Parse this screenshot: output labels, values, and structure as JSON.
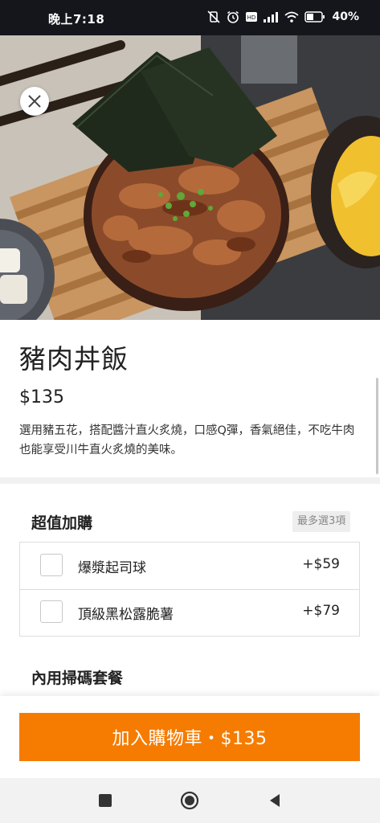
{
  "status_bar": {
    "time": "晚上7:18",
    "battery": "40%",
    "icons": [
      "vibrate-off-icon",
      "alarm-icon",
      "volte-icon",
      "signal-icon",
      "wifi-icon",
      "battery-icon"
    ]
  },
  "hero": {
    "image_alt": "dish-photo",
    "close_icon": "close-icon"
  },
  "product": {
    "name": "豬肉丼飯",
    "price": "$135",
    "description": "選用豬五花，搭配醬汁直火炙燒，口感Q彈，香氣絕佳，不吃牛肉也能享受川牛直火炙燒的美味。"
  },
  "addons": {
    "title": "超值加購",
    "max_label": "最多選3項",
    "options": [
      {
        "name": "爆漿起司球",
        "price": "+$59",
        "checked": false
      },
      {
        "name": "頂級黑松露脆薯",
        "price": "+$79",
        "checked": false
      }
    ]
  },
  "next_section": {
    "title": "內用掃碼套餐"
  },
  "cart": {
    "button_label": "加入購物車・$135"
  },
  "colors": {
    "accent": "#f57c00",
    "status_bar": "#14161c",
    "nav_bar": "#f2f2f2"
  },
  "nav": {
    "icons": [
      "recent-apps-icon",
      "home-icon",
      "back-icon"
    ]
  }
}
